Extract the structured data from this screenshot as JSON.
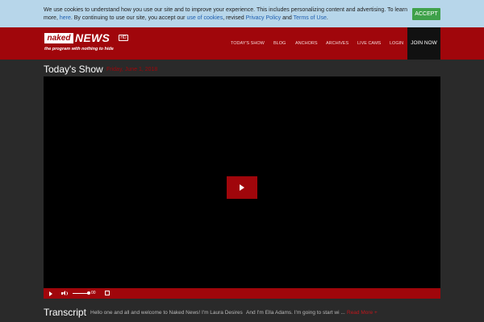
{
  "cookie": {
    "text_1": "We use cookies to understand how you use our site and to improve your experience. This includes personalizing content and advertising. To learn more, ",
    "here": "here",
    "text_2": ". By continuing to use our site, you accept our ",
    "cookies_link": "use of cookies",
    "text_3": ", revised ",
    "privacy_link": "Privacy Policy",
    "text_4": " and ",
    "terms_link": "Terms of Use",
    "text_5": ".",
    "accept_label": "ACCEPT"
  },
  "header": {
    "logo_naked": "naked",
    "logo_news": "NEWS",
    "logo_hd": "HD",
    "tagline": "the program with nothing to hide",
    "nav": [
      "TODAY'S SHOW",
      "BLOG",
      "ANCHORS",
      "ARCHIVES",
      "LIVE CAMS",
      "LOGIN"
    ],
    "join_label": "JOIN NOW"
  },
  "main": {
    "title": "Today's Show",
    "date": "Friday, June 1, 2018"
  },
  "player": {
    "volume_value": "00"
  },
  "transcript": {
    "title": "Transcript",
    "text": "Hello one and all and welcome to Naked News! I'm Laura Desires",
    "text_2": "And I'm Ella Adams. I'm going to start wi ...",
    "read_more": "Read More +"
  },
  "colors": {
    "brand_red": "#a0060b",
    "accept_green": "#3fa14a",
    "cookie_bg": "#b7d6ea"
  }
}
